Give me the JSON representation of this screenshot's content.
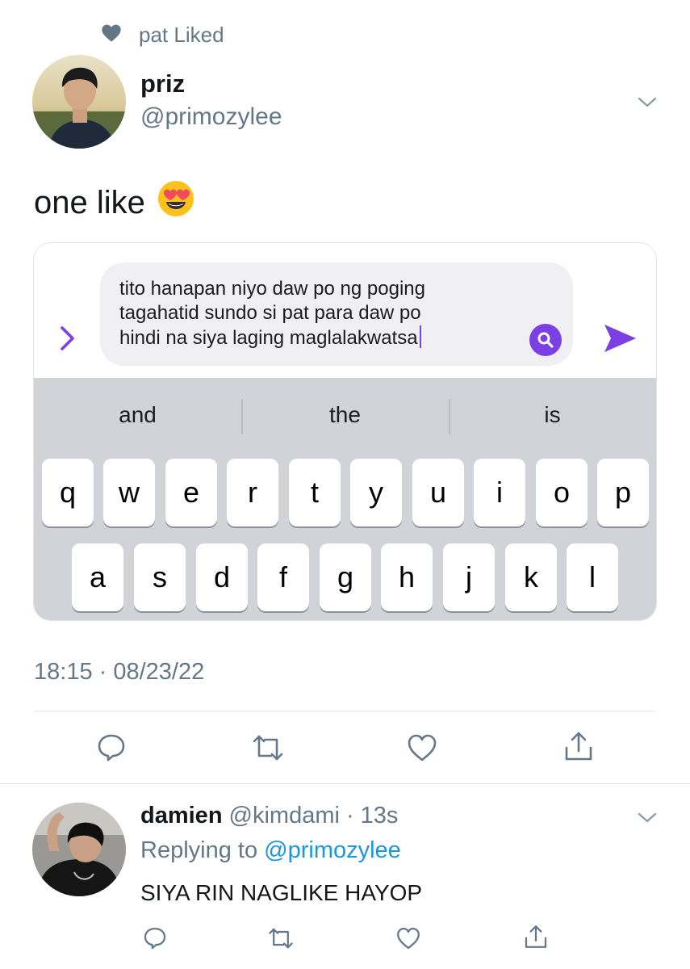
{
  "social_context": {
    "text": "pat Liked",
    "icon": "heart-icon"
  },
  "main_tweet": {
    "author_name": "priz",
    "author_handle": "@primozylee",
    "text": "one like",
    "emoji": "heart-eyes-emoji",
    "timestamp": "18:15 · 08/23/22"
  },
  "embedded_screenshot": {
    "message_text": "tito hanapan niyo daw po ng poging\ntagahatid sundo si pat para daw po\nhindi na siya laging maglalakwatsa",
    "suggestions": [
      "and",
      "the",
      "is"
    ],
    "keyboard_row1": [
      "q",
      "w",
      "e",
      "r",
      "t",
      "y",
      "u",
      "i",
      "o",
      "p"
    ],
    "keyboard_row2": [
      "a",
      "s",
      "d",
      "f",
      "g",
      "h",
      "j",
      "k",
      "l"
    ],
    "accent_color": "#7b3fe4"
  },
  "actions": [
    "reply-icon",
    "retweet-icon",
    "like-icon",
    "share-icon"
  ],
  "reply_tweet": {
    "author_name": "damien",
    "author_handle": "@kimdami",
    "separator": "·",
    "time": "13s",
    "replying_to_prefix": "Replying to",
    "replying_to_handle": "@primozylee",
    "text": "SIYA RIN NAGLIKE HAYOP"
  },
  "colors": {
    "secondary_text": "#657786",
    "link": "#1b95e0",
    "keyboard_bg": "#d1d3d9"
  }
}
